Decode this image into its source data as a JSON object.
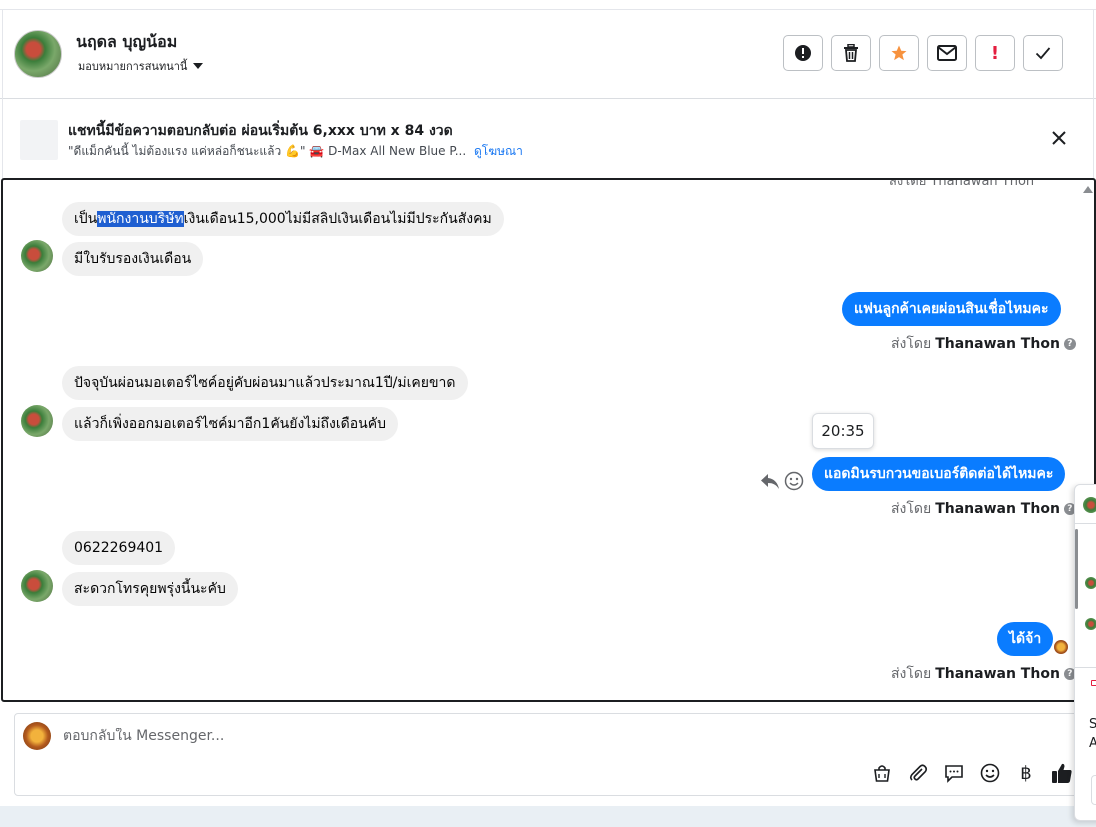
{
  "contact": {
    "name": "นฤดล บุญน้อม",
    "assign_label": "มอบหมายการสนทนานี้"
  },
  "actions": [
    {
      "icon": "alert-circle-icon",
      "label": ""
    },
    {
      "icon": "trash-icon",
      "label": ""
    },
    {
      "icon": "star-icon",
      "label": ""
    },
    {
      "icon": "mail-icon",
      "label": ""
    },
    {
      "icon": "exclamation-icon",
      "label": "!"
    },
    {
      "icon": "check-icon",
      "label": ""
    }
  ],
  "ad_banner": {
    "title": "แชทนี้มีข้อความตอบกลับต่อ ผ่อนเริ่มต้น 6,xxx บาท x 84 งวด",
    "subtitle": "\"ดีแม็กคันนี้ ไม่ต้องแรง แค่หล่อก็ชนะแล้ว 💪\" 🚘 D-Max All New Blue P...",
    "link": "ดูโฆษณา"
  },
  "conversation": {
    "cut_off_sender": "ส่งโดย Thanawan Thon",
    "messages": {
      "m1_before": "เป็น",
      "m1_selected": "พนักงานบริษัท",
      "m1_after": "เงินเดือน15,000ไม่มีสลิปเงินเดือนไม่มีประกันสังคม",
      "m2": "มีใบรับรองเงินเดือน",
      "m3": "แฟนลูกค้าเคยผ่อนสินเชื่อไหมคะ",
      "m4": "ปัจจุบันผ่อนมอเตอร์ไซค์อยู่คับผ่อนมาแล้วประมาณ1ปี/ม่เคยขาด",
      "m5": "แล้วก็เพิ่งออกมอเตอร์ไซค์มาอีก1คันยังไม่ถึงเดือนคับ",
      "m6": "แอดมินรบกวนขอเบอร์ติดต่อได้ไหมคะ",
      "m7": "0622269401",
      "m8": "สะดวกโทรคุยพรุ่งนี้นะคับ",
      "m9": "ได้จ้า"
    },
    "sent_by_prefix": "ส่งโดย",
    "sent_by_name": "Thanawan Thon",
    "timestamp_tooltip": "20:35"
  },
  "composer": {
    "placeholder": "ตอบกลับใน Messenger...",
    "tools": [
      "bag-icon",
      "paperclip-icon",
      "chat-bubble-icon",
      "emoji-icon",
      "baht-icon",
      "thumbs-up-icon"
    ],
    "baht_symbol": "฿"
  },
  "side_panel": {
    "text_s": "S",
    "text_a": "A"
  },
  "colors": {
    "accent": "#0a7cff",
    "star": "#f7923e",
    "danger": "#e41e3f"
  }
}
